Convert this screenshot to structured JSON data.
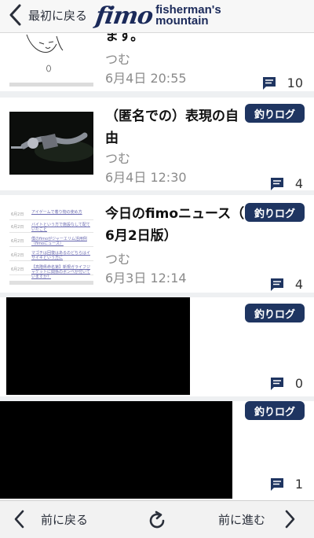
{
  "header": {
    "back_label": "最初に戻る",
    "logo_text": "fimo",
    "logo_tagline_1": "fisherman's",
    "logo_tagline_2": "mountain"
  },
  "articles": [
    {
      "title_tail": "ます。",
      "author": "つむ",
      "date": "6月4日 20:55",
      "comments": "10",
      "badge": ""
    },
    {
      "title_line1": "（匿名での）表現の自",
      "title_line2": "由",
      "author": "つむ",
      "date": "6月4日 12:30",
      "comments": "4",
      "badge": "釣りログ"
    },
    {
      "title_line1": "今日のfimoニュース（",
      "title_line2": "6月2日版）",
      "author": "つむ",
      "date": "6月3日 12:14",
      "comments": "4",
      "badge": "釣りログ",
      "thumb_rows": [
        {
          "d": "6月2日",
          "t": "アイゲームで着り物の使め方"
        },
        {
          "d": "6月2日",
          "t": "バイトという方で施設なして配ていたこと"
        },
        {
          "d": "6月2日",
          "t": "僕のfimoがジャーエリム活用例（fimoにュース）"
        },
        {
          "d": "6月2日",
          "t": "マゴチは回復はあるのどちらはイサイギという方に"
        },
        {
          "d": "6月2日",
          "t": "【高階県命名第】新規ガライフジャケットに関係のボンベが付いていますか？"
        }
      ]
    },
    {
      "author": "",
      "date": "",
      "comments": "0",
      "badge": "釣りログ"
    },
    {
      "author": "",
      "date": "",
      "comments": "1",
      "badge": "釣りログ"
    }
  ],
  "footer": {
    "prev_label": "前に戻る",
    "next_label": "前に進む"
  },
  "colors": {
    "badge": "#1f3561",
    "brand": "#1b2a5a"
  }
}
